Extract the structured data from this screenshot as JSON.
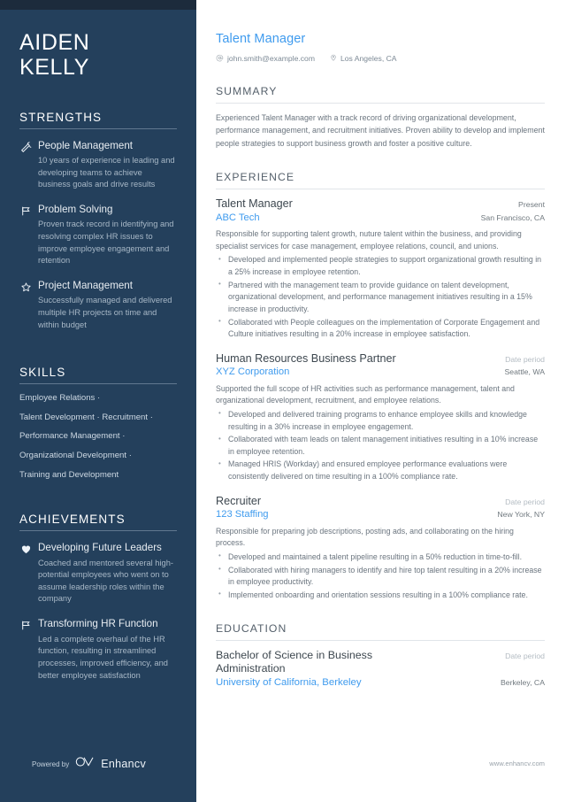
{
  "sidebar": {
    "name_lines": [
      "AIDEN",
      "KELLY"
    ],
    "strengths_heading": "STRENGTHS",
    "strengths": [
      {
        "icon": "magic-wand-icon",
        "title": "People Management",
        "desc": "10 years of experience in leading and developing teams to achieve business goals and drive results"
      },
      {
        "icon": "flag-icon",
        "title": "Problem Solving",
        "desc": "Proven track record in identifying and resolving complex HR issues to improve employee engagement and retention"
      },
      {
        "icon": "star-icon",
        "title": "Project Management",
        "desc": "Successfully managed and delivered multiple HR projects on time and within budget"
      }
    ],
    "skills_heading": "SKILLS",
    "skills_lines": [
      "Employee Relations ·",
      "Talent Development · Recruitment ·",
      "Performance Management ·",
      "Organizational Development ·",
      "Training and Development"
    ],
    "achievements_heading": "ACHIEVEMENTS",
    "achievements": [
      {
        "icon": "heart-icon",
        "title": "Developing Future Leaders",
        "desc": "Coached and mentored several high-potential employees who went on to assume leadership roles within the company"
      },
      {
        "icon": "flag-icon",
        "title": "Transforming HR Function",
        "desc": "Led a complete overhaul of the HR function, resulting in streamlined processes, improved efficiency, and better employee satisfaction"
      }
    ],
    "footer": {
      "powered_by": "Powered by",
      "brand": "Enhancv"
    }
  },
  "main": {
    "headline": "Talent Manager",
    "email": "john.smith@example.com",
    "location": "Los Angeles, CA",
    "summary_heading": "SUMMARY",
    "summary": "Experienced Talent Manager with a track record of driving organizational development, performance management, and recruitment initiatives. Proven ability to develop and implement people strategies to support business growth and foster a positive culture.",
    "experience_heading": "EXPERIENCE",
    "experience": [
      {
        "title": "Talent Manager",
        "org": "ABC Tech",
        "date": "Present",
        "date_muted": false,
        "place": "San Francisco, CA",
        "desc": "Responsible for supporting talent growth, nuture talent within the business, and providing specialist services for case management, employee relations, council, and unions.",
        "bullets": [
          "Developed and implemented people strategies to support organizational growth resulting in a 25% increase in employee retention.",
          "Partnered with the management team to provide guidance on talent development, organizational development, and performance management initiatives resulting in a 15% increase in productivity.",
          "Collaborated with People colleagues on the implementation of Corporate Engagement and Culture initiatives resulting in a 20% increase in employee satisfaction."
        ]
      },
      {
        "title": "Human Resources Business Partner",
        "org": "XYZ Corporation",
        "date": "Date period",
        "date_muted": true,
        "place": "Seattle, WA",
        "desc": "Supported the full scope of HR activities such as performance management, talent and organizational development, recruitment, and employee relations.",
        "bullets": [
          "Developed and delivered training programs to enhance employee skills and knowledge resulting in a 30% increase in employee engagement.",
          "Collaborated with team leads on talent management initiatives resulting in a 10% increase in employee retention.",
          "Managed HRIS (Workday) and ensured employee performance evaluations were consistently delivered on time resulting in a 100% compliance rate."
        ]
      },
      {
        "title": "Recruiter",
        "org": "123 Staffing",
        "date": "Date period",
        "date_muted": true,
        "place": "New York, NY",
        "desc": "Responsible for preparing job descriptions, posting ads, and collaborating on the hiring process.",
        "bullets": [
          "Developed and maintained a talent pipeline resulting in a 50% reduction in time-to-fill.",
          "Collaborated with hiring managers to identify and hire top talent resulting in a 20% increase in employee productivity.",
          "Implemented onboarding and orientation sessions resulting in a 100% compliance rate."
        ]
      }
    ],
    "education_heading": "EDUCATION",
    "education": [
      {
        "degree": "Bachelor of Science in Business Administration",
        "school": "University of California, Berkeley",
        "date": "Date period",
        "place": "Berkeley, CA"
      }
    ],
    "website": "www.enhancv.com"
  },
  "colors": {
    "accent": "#3f9bee",
    "sidebar": "#24405c",
    "topbar": "#1c2b3c"
  }
}
